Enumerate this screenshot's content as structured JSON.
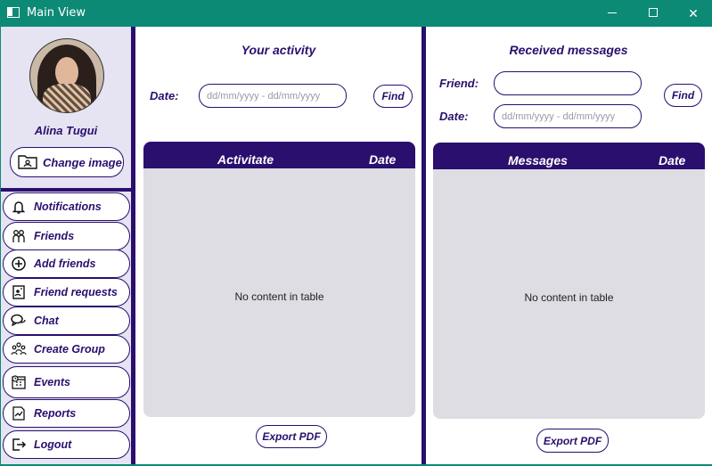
{
  "window": {
    "title": "Main View",
    "controls": {
      "minimize": "—",
      "maximize": "☐",
      "close": "✕"
    }
  },
  "sidebar": {
    "user_name": "Alina Tugui",
    "change_image_label": "Change image",
    "items": [
      {
        "label": "Notifications",
        "icon": "bell-icon"
      },
      {
        "label": "Friends",
        "icon": "friends-icon"
      },
      {
        "label": "Add friends",
        "icon": "add-circle-icon"
      },
      {
        "label": "Friend requests",
        "icon": "request-doc-icon"
      },
      {
        "label": "Chat",
        "icon": "chat-bubbles-icon"
      },
      {
        "label": "Create Group",
        "icon": "group-icon"
      },
      {
        "label": "Events",
        "icon": "calendar-clock-icon"
      },
      {
        "label": "Reports",
        "icon": "report-chart-icon"
      },
      {
        "label": "Logout",
        "icon": "logout-icon"
      }
    ]
  },
  "activity": {
    "title": "Your activity",
    "date_label": "Date:",
    "date_placeholder": "dd/mm/yyyy - dd/mm/yyyy",
    "find_label": "Find",
    "columns": [
      "Activitate",
      "Date"
    ],
    "empty_text": "No content in table",
    "export_label": "Export PDF"
  },
  "messages": {
    "title": "Received messages",
    "friend_label": "Friend:",
    "friend_value": "",
    "date_label": "Date:",
    "date_placeholder": "dd/mm/yyyy - dd/mm/yyyy",
    "find_label": "Find",
    "columns": [
      "Messages",
      "Date"
    ],
    "empty_text": "No content in table",
    "export_label": "Export PDF"
  },
  "colors": {
    "accent": "#2a0f6e",
    "titlebar": "#0d8a76",
    "sidebar_bg": "#e6e3f2",
    "table_bg": "#dddde3"
  }
}
